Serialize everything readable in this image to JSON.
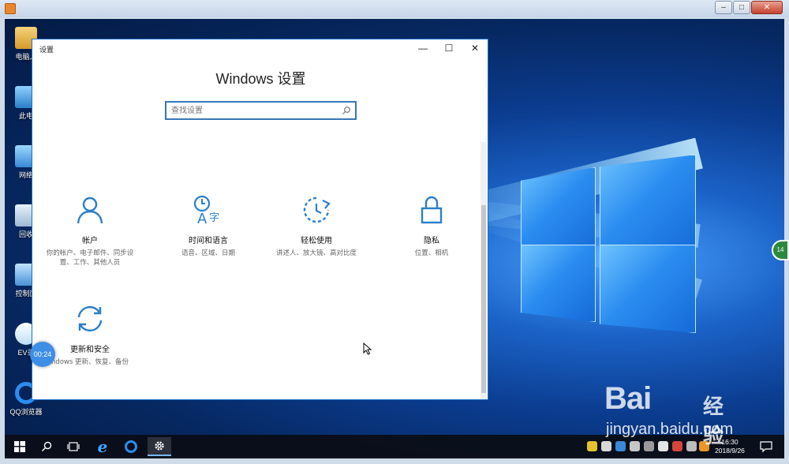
{
  "desktop": {
    "icons": [
      {
        "label": "电脑人"
      },
      {
        "label": "此电"
      },
      {
        "label": "网络"
      },
      {
        "label": "回收"
      },
      {
        "label": "控制面"
      },
      {
        "label": "EV录"
      },
      {
        "label": "QQ浏览器"
      }
    ]
  },
  "settings_window": {
    "title": "设置",
    "heading": "Windows 设置",
    "search_placeholder": "查找设置",
    "controls": {
      "minimize": "—",
      "maximize": "☐",
      "close": "✕"
    },
    "tiles": [
      {
        "icon": "person-icon",
        "title": "帐户",
        "desc": "你的帐户、电子邮件、同步设置、工作、其他人员"
      },
      {
        "icon": "time-language-icon",
        "title": "时间和语言",
        "desc": "语音、区域、日期"
      },
      {
        "icon": "ease-of-access-icon",
        "title": "轻松使用",
        "desc": "讲述人、放大镜、高对比度"
      },
      {
        "icon": "lock-icon",
        "title": "隐私",
        "desc": "位置、相机"
      },
      {
        "icon": "sync-icon",
        "title": "更新和安全",
        "desc": "ndows 更新、恢复、备份"
      }
    ]
  },
  "recording_timer": "00:24",
  "side_badge": "14",
  "taskbar": {
    "clock_time": "16:30",
    "clock_date": "2018/9/26"
  },
  "watermark": {
    "brand": "Bai",
    "brand_suffix": "经验",
    "url": "jingyan.baidu.com"
  },
  "colors": {
    "accent": "#1f7ad6",
    "icon_blue": "#2a7fc9",
    "desktop_dark": "#06275f"
  }
}
